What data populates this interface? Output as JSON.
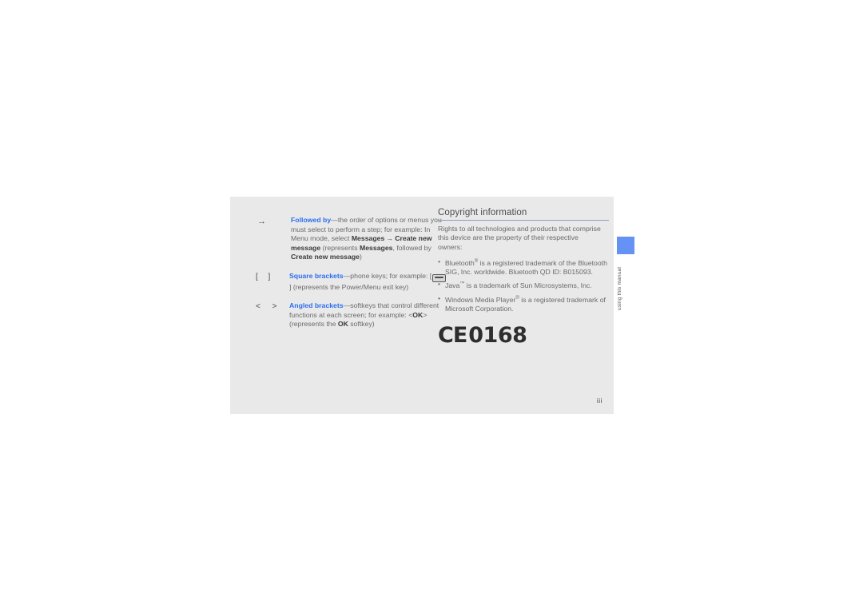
{
  "page": {
    "number": "iii",
    "background_color": "#e9e9e9",
    "outer_background_color": "#ffffff"
  },
  "side_tab": {
    "label": "using this manual",
    "accent_color": "#6691f5"
  },
  "conventions": {
    "items": [
      {
        "symbol": "→",
        "term": "Followed by",
        "dash": "—",
        "desc_part1": "the order of options or menus you must select to perform a step; for example: In Menu mode, select ",
        "bold1": "Messages",
        "inline_arrow": "→",
        "bold2": "Create new message",
        "desc_part2": " (represents ",
        "bold3": "Messages",
        "desc_part3": ", followed by ",
        "bold4": "Create new message",
        "desc_part4": ")"
      },
      {
        "symbol": "[  ]",
        "term": "Square brackets",
        "dash": "—",
        "desc_part1": "phone keys; for example: [",
        "key_icon": "power-menu-exit-key-icon",
        "desc_part2": "] (represents the Power/Menu exit key)"
      },
      {
        "symbol": "<  >",
        "term": "Angled brackets",
        "dash": "—",
        "desc_part1": "softkeys that control different functions at each screen; for example: <",
        "bold1": "OK",
        "desc_part2": "> (represents the ",
        "bold2": "OK",
        "desc_part3": " softkey)"
      }
    ]
  },
  "copyright": {
    "heading": "Copyright information",
    "rule_color": "#8b9ec4",
    "intro": "Rights to all technologies and products that comprise this device are the property of their respective owners:",
    "trademarks": [
      {
        "name": "Bluetooth",
        "mark": "®",
        "text": " is a registered trademark of the Bluetooth SIG, Inc. worldwide. Bluetooth QD ID: B015093."
      },
      {
        "name": "Java",
        "mark": "™",
        "text": " is a trademark of Sun Microsystems, Inc."
      },
      {
        "name": "Windows Media Player",
        "mark": "®",
        "text": " is a registered trademark of Microsoft Corporation."
      }
    ]
  },
  "ce_mark": {
    "letters": "CE",
    "number": "0168"
  }
}
